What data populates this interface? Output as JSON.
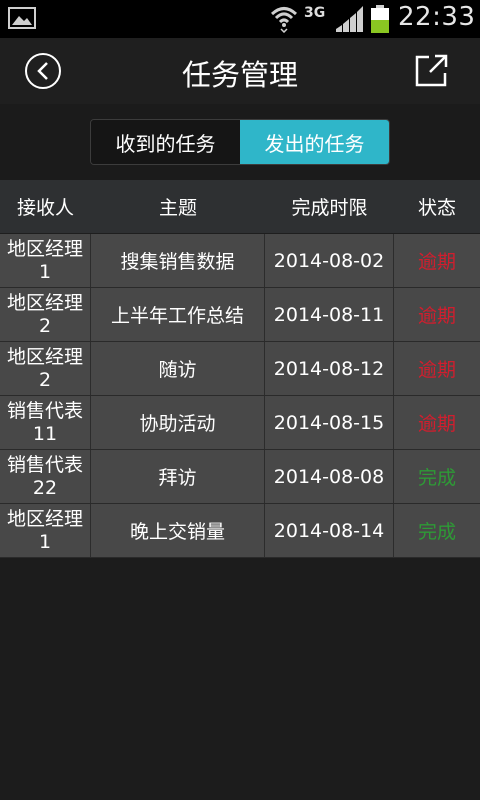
{
  "status_bar": {
    "network": "3G",
    "time": "22:33"
  },
  "header": {
    "title": "任务管理",
    "back_icon": "chevron-left-circle-icon",
    "share_icon": "external-share-icon"
  },
  "tabs": [
    {
      "label": "收到的任务",
      "active": false
    },
    {
      "label": "发出的任务",
      "active": true
    }
  ],
  "table": {
    "columns": [
      "接收人",
      "主题",
      "完成时限",
      "状态"
    ],
    "rows": [
      {
        "receiver": "地区经理1",
        "subject": "搜集销售数据",
        "deadline": "2014-08-02",
        "status": "逾期",
        "status_color": "#d01e2e"
      },
      {
        "receiver": "地区经理2",
        "subject": "上半年工作总结",
        "deadline": "2014-08-11",
        "status": "逾期",
        "status_color": "#d01e2e"
      },
      {
        "receiver": "地区经理2",
        "subject": "随访",
        "deadline": "2014-08-12",
        "status": "逾期",
        "status_color": "#d01e2e"
      },
      {
        "receiver": "销售代表11",
        "subject": "协助活动",
        "deadline": "2014-08-15",
        "status": "逾期",
        "status_color": "#d01e2e"
      },
      {
        "receiver": "销售代表22",
        "subject": "拜访",
        "deadline": "2014-08-08",
        "status": "完成",
        "status_color": "#2e9a36"
      },
      {
        "receiver": "地区经理1",
        "subject": "晚上交销量",
        "deadline": "2014-08-14",
        "status": "完成",
        "status_color": "#2e9a36"
      }
    ]
  },
  "colors": {
    "accent": "#2fb6c9",
    "overdue": "#d01e2e",
    "done": "#2e9a36"
  }
}
